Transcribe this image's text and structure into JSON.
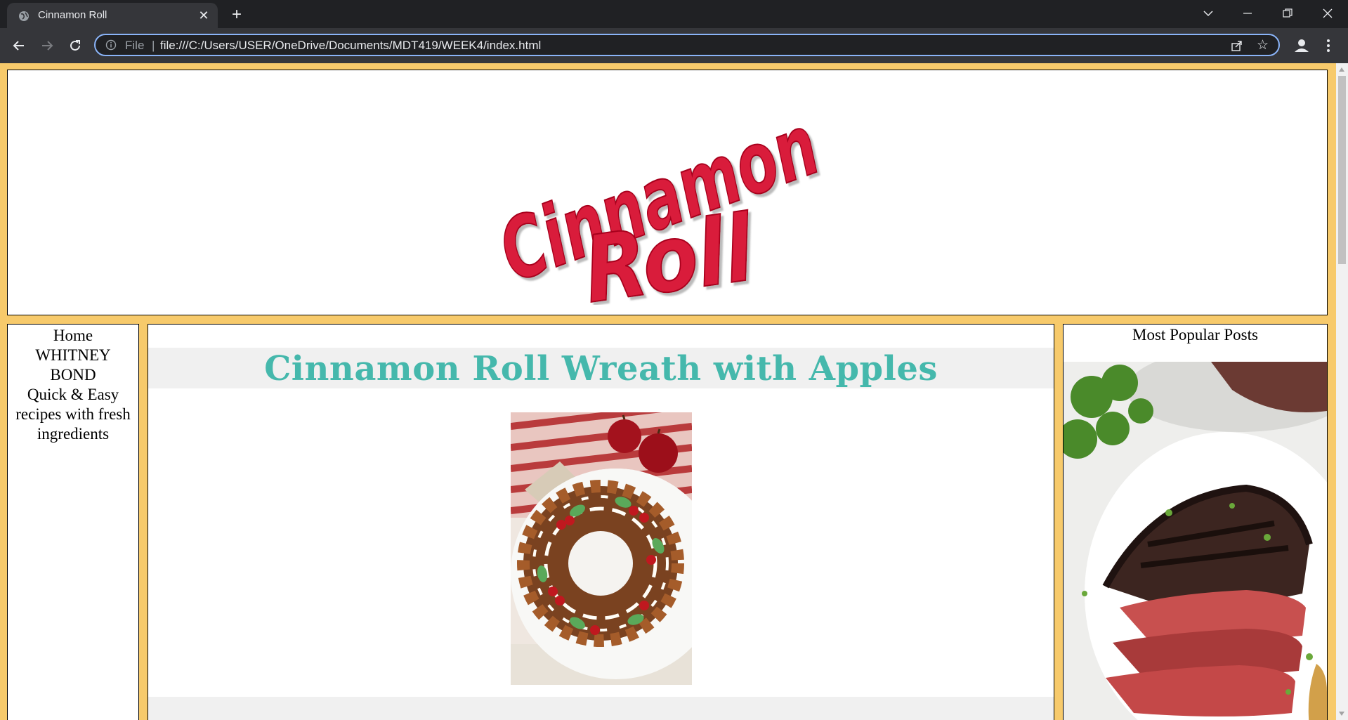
{
  "browser": {
    "tab_title": "Cinnamon Roll",
    "new_tab_symbol": "+",
    "omnibox": {
      "scheme_label": "File",
      "separator": "|",
      "url": "file:///C:/Users/USER/OneDrive/Documents/MDT419/WEEK4/index.html"
    }
  },
  "page": {
    "logo_text": [
      "Cinnamon",
      "Roll"
    ],
    "nav": {
      "home": "Home",
      "author_line1": "WHITNEY",
      "author_line2": "BOND",
      "tagline_line1": "Quick & Easy",
      "tagline_line2": "recipes with fresh",
      "tagline_line3": "ingredients"
    },
    "post": {
      "title": "Cinnamon Roll Wreath with Apples"
    },
    "sidebar": {
      "heading": "Most Popular Posts"
    }
  },
  "colors": {
    "page_background": "#f7ca6b",
    "title_color": "#45b8ac",
    "logo_red": "#d91c3a"
  },
  "icons": [
    "globe-icon",
    "close-icon",
    "plus-icon",
    "chevron-down-icon",
    "minimize-icon",
    "restore-icon",
    "window-close-icon",
    "back-arrow-icon",
    "forward-arrow-icon",
    "reload-icon",
    "info-icon",
    "share-icon",
    "star-icon",
    "profile-icon",
    "menu-dots-icon"
  ]
}
